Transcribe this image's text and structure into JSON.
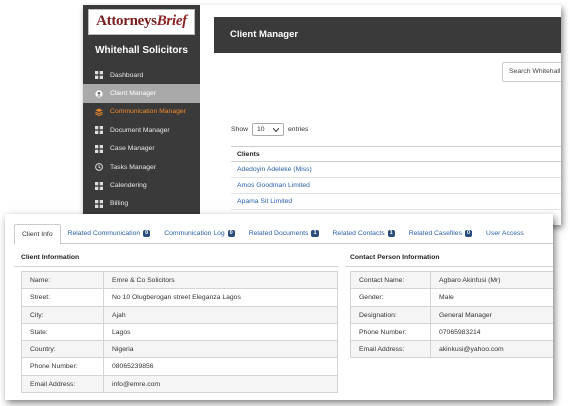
{
  "app": {
    "logo": {
      "part1": "Attorneys",
      "part2": "Brief"
    },
    "firm_name": "Whitehall Solicitors",
    "nav": [
      {
        "label": "Dashboard",
        "icon": "grid-icon",
        "state": "normal"
      },
      {
        "label": "Client Manager",
        "icon": "user-circle-icon",
        "state": "active"
      },
      {
        "label": "Communication Manager",
        "icon": "layers-icon",
        "state": "orange"
      },
      {
        "label": "Document Manager",
        "icon": "grid-icon",
        "state": "normal"
      },
      {
        "label": "Case Manager",
        "icon": "grid-icon",
        "state": "normal"
      },
      {
        "label": "Tasks Manager",
        "icon": "clock-icon",
        "state": "normal"
      },
      {
        "label": "Calendering",
        "icon": "grid-icon",
        "state": "normal"
      },
      {
        "label": "Billing",
        "icon": "grid-icon",
        "state": "normal"
      }
    ],
    "main_title": "Client Manager",
    "search_placeholder": "Search Whitehall",
    "show": {
      "prefix": "Show",
      "value": "10",
      "suffix": "entries"
    },
    "clients_header": "Clients",
    "clients": [
      "Adedoyin Adeleke (Miss)",
      "Amos Goodman Limited",
      "Apama Sit Limited"
    ]
  },
  "panel": {
    "tabs": [
      {
        "label": "Client Info",
        "active": true,
        "badge": null
      },
      {
        "label": "Related Communication",
        "active": false,
        "badge": "0"
      },
      {
        "label": "Communication Log",
        "active": false,
        "badge": "0"
      },
      {
        "label": "Related Documents",
        "active": false,
        "badge": "1"
      },
      {
        "label": "Related Contacts",
        "active": false,
        "badge": "1"
      },
      {
        "label": "Related Casefiles",
        "active": false,
        "badge": "0"
      },
      {
        "label": "User Access",
        "active": false,
        "badge": null
      }
    ],
    "client_info_title": "Client Information",
    "client_info": [
      {
        "label": "Name:",
        "value": "Emre & Co Solicitors"
      },
      {
        "label": "Street:",
        "value": "No 10 Olugberogan street Eleganza Lagos"
      },
      {
        "label": "City:",
        "value": "Ajah"
      },
      {
        "label": "State:",
        "value": "Lagos"
      },
      {
        "label": "Country:",
        "value": "Nigeria"
      },
      {
        "label": "Phone Number:",
        "value": "08065239856"
      },
      {
        "label": "Email Address:",
        "value": "info@emre.com"
      }
    ],
    "contact_title": "Contact Person Information",
    "contact_info": [
      {
        "label": "Contact Name:",
        "value": "Agbaro Akinfusi (Mr)"
      },
      {
        "label": "Gender:",
        "value": "Male"
      },
      {
        "label": "Designation:",
        "value": "General Manager"
      },
      {
        "label": "Phone Number:",
        "value": "07065983214"
      },
      {
        "label": "Email Address:",
        "value": "akinkusi@yahoo.com"
      }
    ]
  }
}
